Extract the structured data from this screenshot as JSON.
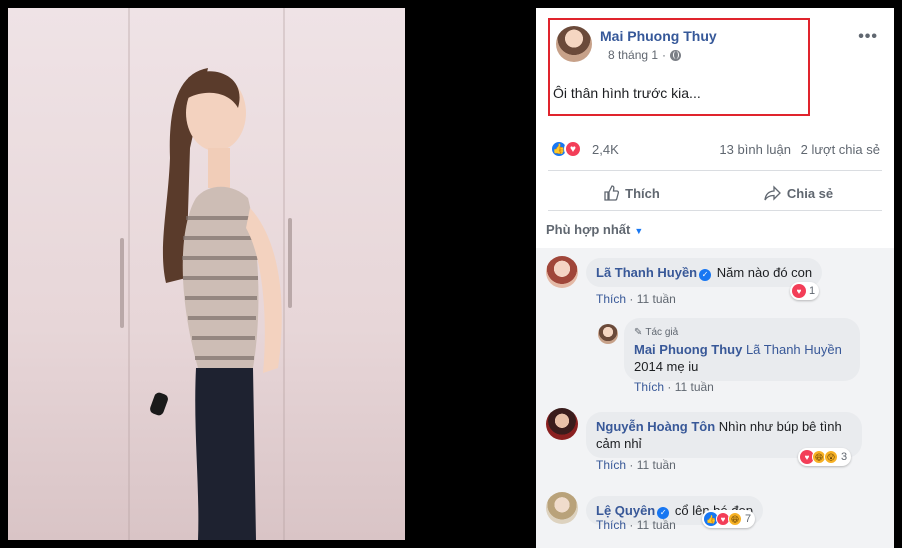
{
  "post": {
    "author": "Mai Phuong Thuy",
    "time": "8 tháng 1",
    "separator": "·",
    "text": "Ôi thân hình trước kia...",
    "more": "•••"
  },
  "stats": {
    "reactions": "2,4K",
    "comments": "13 bình luận",
    "shares": "2 lượt chia sẻ"
  },
  "actions": {
    "like": "Thích",
    "share": "Chia sẻ"
  },
  "sort": {
    "label": "Phù hợp nhất"
  },
  "comments": [
    {
      "name": "Lã Thanh Huyền",
      "verified": true,
      "text": "Năm nào đó con",
      "like_label": "Thích",
      "time": "11 tuần",
      "reaction_count": "1"
    },
    {
      "author_tag": "Tác giả",
      "name": "Mai Phuong Thuy",
      "mention": "Lã Thanh Huyền",
      "text": "2014 mẹ iu",
      "like_label": "Thích",
      "time": "11 tuần"
    },
    {
      "name": "Nguyễn Hoàng Tôn",
      "text": "Nhìn như búp bê tình cảm nhỉ",
      "text_line1": "Nhìn như búp bê tình",
      "text_line2": "cảm nhỉ",
      "like_label": "Thích",
      "time": "11 tuần",
      "reaction_count": "3"
    },
    {
      "name": "Lệ Quyên",
      "verified": true,
      "text": "cổ lên bé đẹp",
      "like_label": "Thích",
      "time": "11 tuần",
      "reaction_count": "7"
    }
  ],
  "colors": {
    "highlight_border": "#e0242d",
    "link": "#385898",
    "like_blue": "#1877f2",
    "love_red": "#f33e58"
  }
}
